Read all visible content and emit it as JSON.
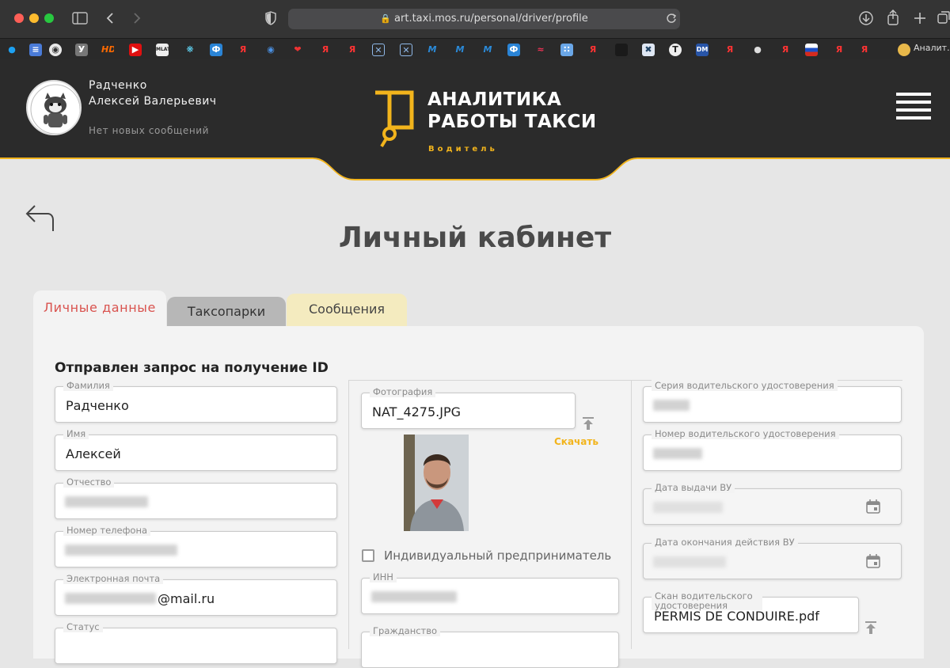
{
  "browser": {
    "url": "art.taxi.mos.ru/personal/driver/profile",
    "bookmark_last_label": "Аналит…",
    "bookmark_letters": [
      "У",
      "Я",
      "Я",
      "Я",
      "Я",
      "Я",
      "Я",
      "Я"
    ]
  },
  "header": {
    "user_name_line1": "Радченко",
    "user_name_line2": "Алексей Валерьевич",
    "no_messages": "Нет новых сообщений",
    "logo_line1": "АНАЛИТИКА",
    "logo_line2": "РАБОТЫ ТАКСИ",
    "role": "Водитель",
    "accent_color": "#f2b41c"
  },
  "page": {
    "title": "Личный кабинет"
  },
  "tabs": [
    {
      "label": "Личные данные",
      "active": true
    },
    {
      "label": "Таксопарки",
      "active": false
    },
    {
      "label": "Сообщения",
      "active": false
    }
  ],
  "form": {
    "status_heading": "Отправлен запрос на получение ID",
    "col1": {
      "surname_label": "Фамилия",
      "surname_value": "Радченко",
      "name_label": "Имя",
      "name_value": "Алексей",
      "patronymic_label": "Отчество",
      "phone_label": "Номер телефона",
      "email_label": "Электронная почта",
      "email_suffix": "@mail.ru",
      "status_label": "Статус"
    },
    "col2": {
      "photo_label": "Фотография",
      "photo_filename": "NAT_4275.JPG",
      "download_label": "Скачать",
      "ip_checkbox_label": "Индивидуальный предприниматель",
      "inn_label": "ИНН",
      "citizenship_label": "Гражданство"
    },
    "col3": {
      "license_series_label": "Серия водительского удостоверения",
      "license_number_label": "Номер водительского удостоверения",
      "issue_date_label": "Дата выдачи ВУ",
      "expiry_date_label": "Дата окончания действия ВУ",
      "scan_label": "Скан водительского удостоверения",
      "scan_filename": "PERMIS DE CONDUIRE.pdf"
    }
  }
}
